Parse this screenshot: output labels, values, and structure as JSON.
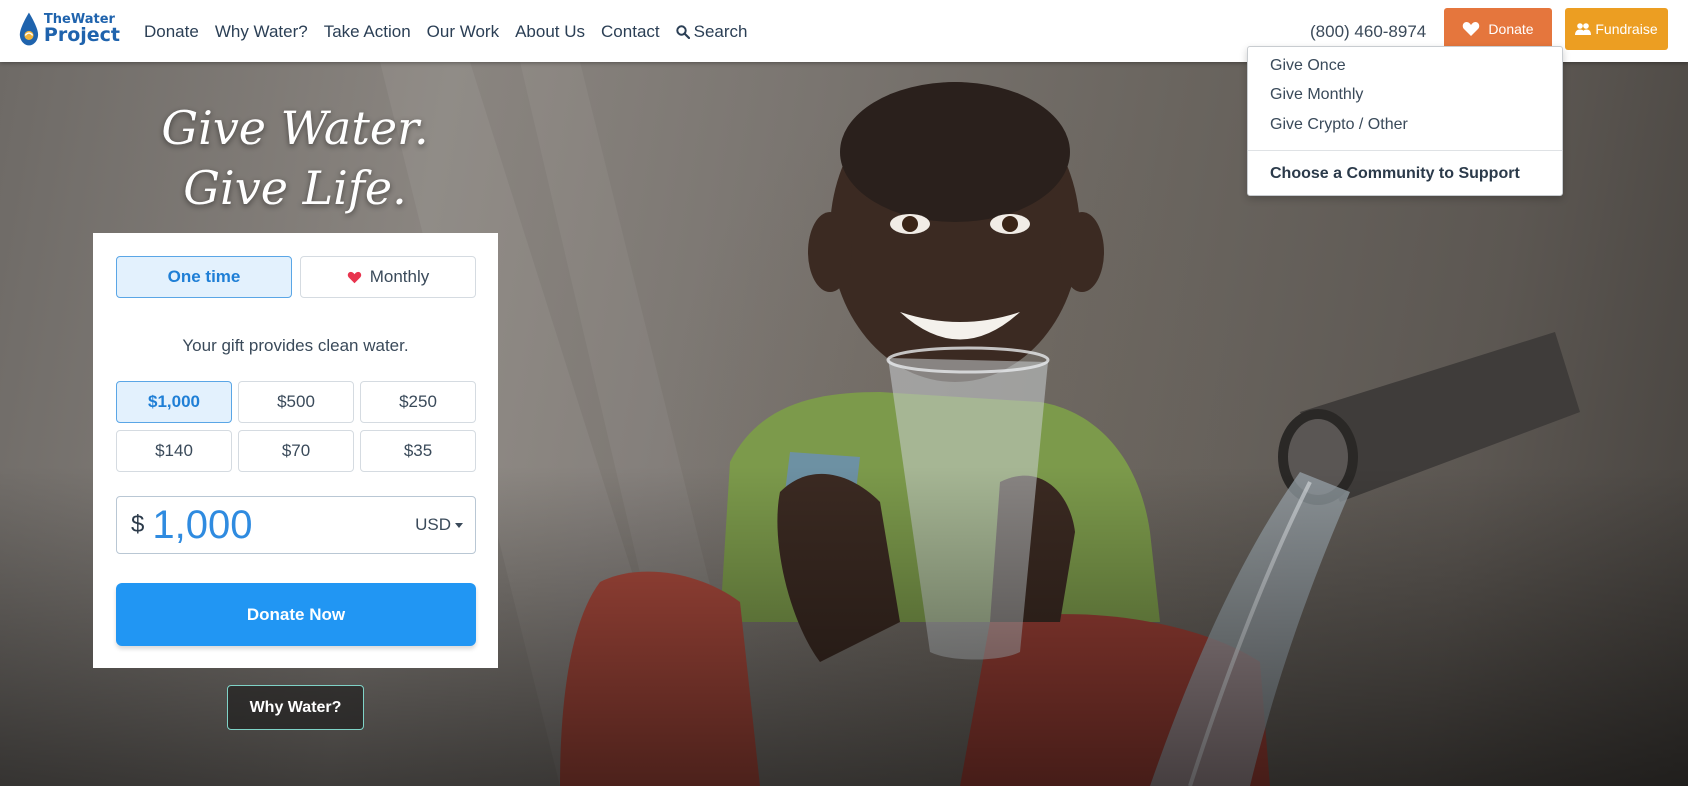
{
  "header": {
    "logo": {
      "line1": "TheWater",
      "line2": "Project",
      "drop_color": "#1f63ad"
    },
    "nav": [
      {
        "label": "Donate"
      },
      {
        "label": "Why Water?"
      },
      {
        "label": "Take Action"
      },
      {
        "label": "Our Work"
      },
      {
        "label": "About Us"
      },
      {
        "label": "Contact"
      },
      {
        "label": "Search",
        "icon": "search-icon"
      }
    ],
    "phone": "(800) 460-8974",
    "donate_button": {
      "label": "Donate",
      "icon": "heart-icon",
      "color": "#e5763d"
    },
    "fundraise_button": {
      "label": "Fundraise",
      "icon": "users-icon",
      "color": "#ec9e22"
    }
  },
  "dropdown": {
    "items": [
      "Give Once",
      "Give Monthly",
      "Give Crypto / Other"
    ],
    "featured": "Choose a Community to Support"
  },
  "hero": {
    "tagline_line1": "Give Water.",
    "tagline_line2": "Give Life."
  },
  "donation_form": {
    "frequency": {
      "one_time": "One time",
      "monthly": "Monthly",
      "selected": "One time"
    },
    "gift_text": "Your gift provides clean water.",
    "amounts": [
      "$1,000",
      "$500",
      "$250",
      "$140",
      "$70",
      "$35"
    ],
    "selected_amount": "$1,000",
    "currency_symbol": "$",
    "amount_value": "1,000",
    "currency_code": "USD",
    "submit_label": "Donate Now",
    "accent_color": "#2196f3"
  },
  "why_water_button": "Why Water?"
}
